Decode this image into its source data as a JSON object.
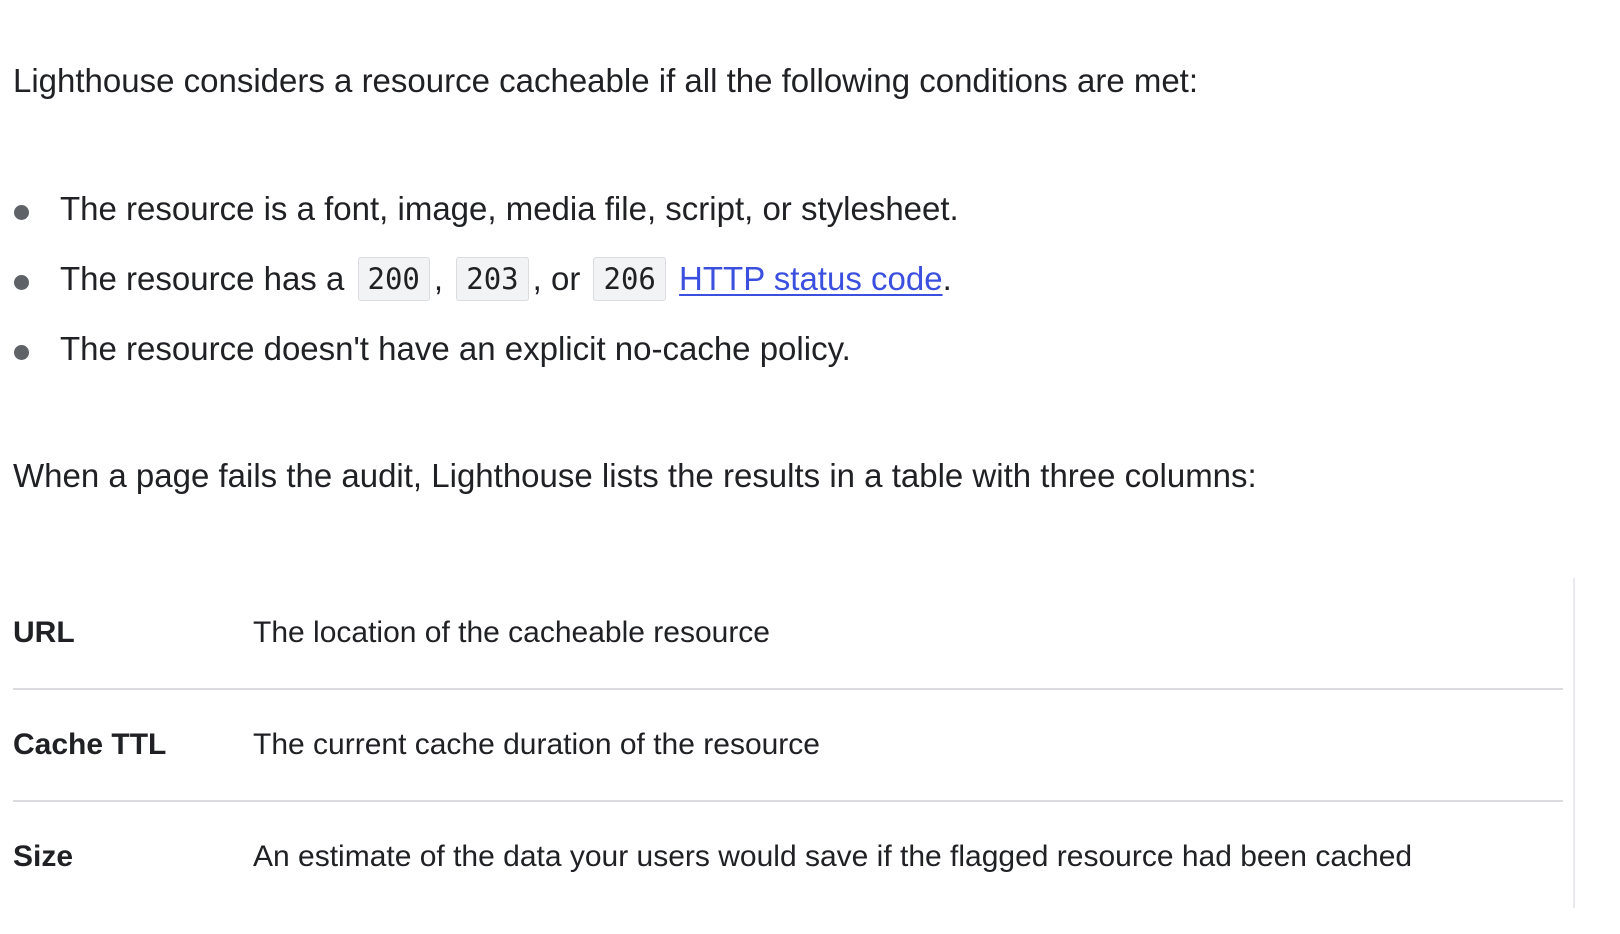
{
  "intro_text": "Lighthouse considers a resource cacheable if all the following conditions are met:",
  "conditions": {
    "item1": "The resource is a font, image, media file, script, or stylesheet.",
    "item2": {
      "prefix": "The resource has a",
      "code1": "200",
      "sep1": ",",
      "code2": "203",
      "sep2": ", or",
      "code3": "206",
      "link_text": "HTTP status code",
      "suffix": "."
    },
    "item3": "The resource doesn't have an explicit no-cache policy."
  },
  "table_intro": "When a page fails the audit, Lighthouse lists the results in a table with three columns:",
  "table": {
    "rows": [
      {
        "key": "URL",
        "value": "The location of the cacheable resource"
      },
      {
        "key": "Cache TTL",
        "value": "The current cache duration of the resource"
      },
      {
        "key": "Size",
        "value": "An estimate of the data your users would save if the flagged resource had been cached"
      }
    ]
  },
  "colors": {
    "text": "#202124",
    "link": "#3c50e0",
    "bullet": "#5f6368",
    "divider": "#dadce0",
    "code_bg": "#f1f3f4"
  }
}
